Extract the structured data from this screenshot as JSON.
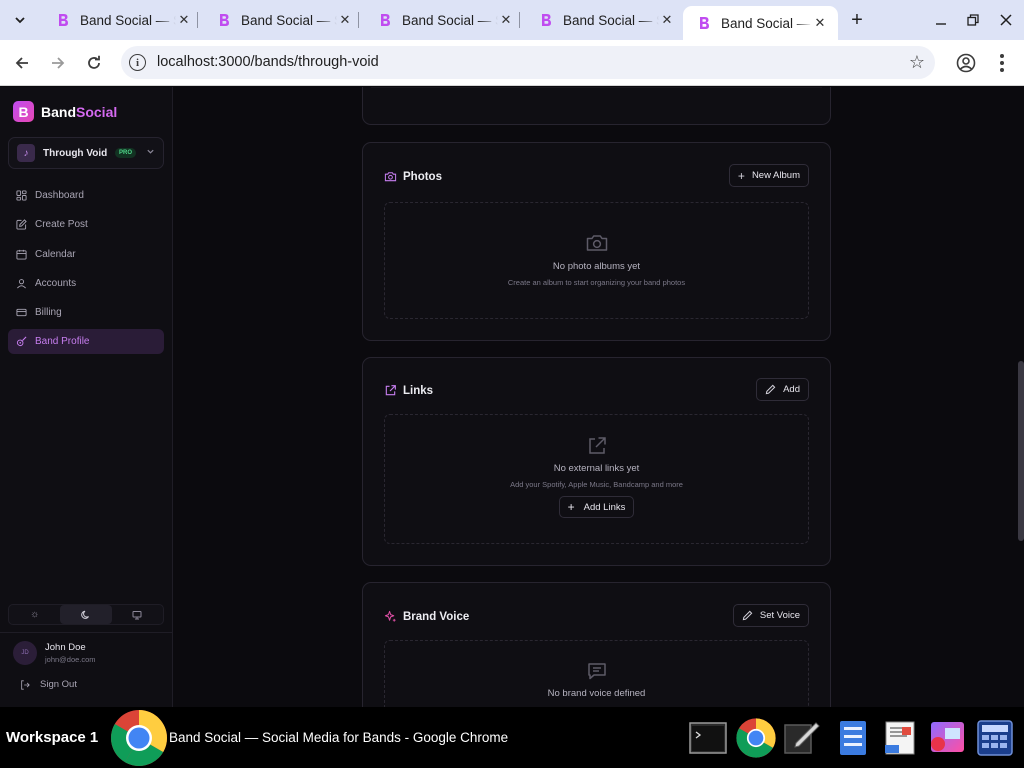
{
  "browser": {
    "tabs": [
      {
        "title": "Band Social — Social Media for Bands",
        "active": false
      },
      {
        "title": "Band Social — Social Media for Bands",
        "active": false
      },
      {
        "title": "Band Social — Social Media for Bands",
        "active": false
      },
      {
        "title": "Band Social — Social Media for Bands",
        "active": false
      },
      {
        "title": "Band Social — Social Media for Bands",
        "active": true
      }
    ],
    "url": "localhost:3000/bands/through-void"
  },
  "sidebar": {
    "brand_a": "Band",
    "brand_b": "Social",
    "logo_letter": "B",
    "band": {
      "name": "Through Void",
      "badge": "PRO"
    },
    "items": [
      {
        "label": "Dashboard",
        "icon": "dashboard-icon"
      },
      {
        "label": "Create Post",
        "icon": "edit-icon"
      },
      {
        "label": "Calendar",
        "icon": "calendar-icon"
      },
      {
        "label": "Accounts",
        "icon": "user-icon"
      },
      {
        "label": "Billing",
        "icon": "credit-card-icon"
      },
      {
        "label": "Band Profile",
        "icon": "guitar-icon",
        "active": true
      }
    ],
    "theme_modes": [
      "light",
      "dark",
      "system"
    ],
    "user": {
      "initials": "JD",
      "name": "John Doe",
      "email": "john@doe.com"
    },
    "signout": "Sign Out"
  },
  "main": {
    "photos": {
      "title": "Photos",
      "button": "New Album",
      "empty_title": "No photo albums yet",
      "empty_sub": "Create an album to start organizing your band photos"
    },
    "links": {
      "title": "Links",
      "button": "Add",
      "empty_title": "No external links yet",
      "empty_sub": "Add your Spotify, Apple Music, Bandcamp and more",
      "empty_button": "Add Links"
    },
    "brand_voice": {
      "title": "Brand Voice",
      "button": "Set Voice",
      "empty_title": "No brand voice defined"
    }
  },
  "taskbar": {
    "workspace": "Workspace 1",
    "window_title": "Band Social — Social Media for Bands - Google Chrome"
  },
  "colors": {
    "accent": "#c77ef0",
    "brand_gradient_start": "#c04cf0",
    "brand_gradient_end": "#e648b3",
    "background": "#0b0a0e"
  }
}
